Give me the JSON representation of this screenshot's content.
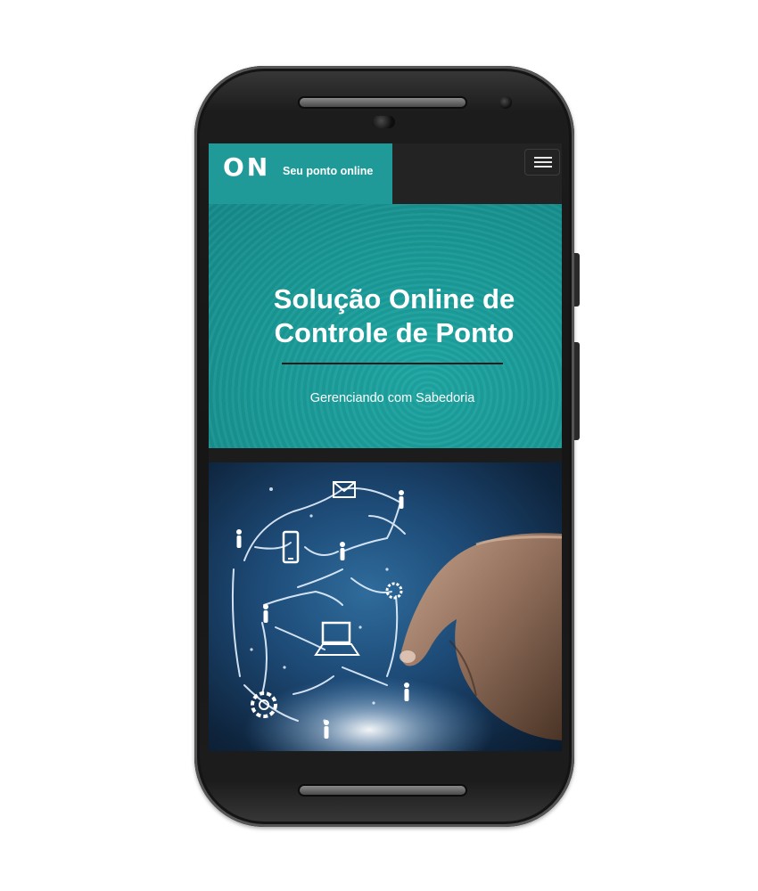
{
  "brand": {
    "logo_text": "ON",
    "tagline": "Seu ponto online"
  },
  "hero": {
    "title_line1": "Solução Online de",
    "title_line2": "Controle de Ponto",
    "subtitle": "Gerenciando com Sabedoria"
  },
  "icons": {
    "menu": "hamburger-menu-icon",
    "network": [
      "envelope-icon",
      "person-icon",
      "smartphone-icon",
      "laptop-icon",
      "gear-icon"
    ]
  },
  "colors": {
    "brand_teal": "#1f9a98",
    "navbar_dark": "#232323",
    "phone_body": "#1c1c1c"
  }
}
